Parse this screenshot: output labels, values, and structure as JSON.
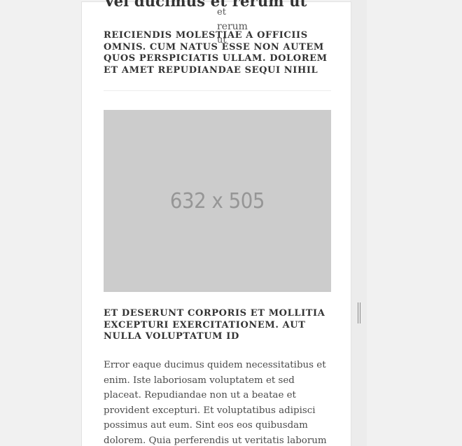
{
  "article": {
    "title": "Vel ducimus et rerum ut",
    "overflow_words": [
      "et",
      "rerum",
      "ut"
    ],
    "subtitle": "Reiciendis molestiae a officiis omnis. Cum natus esse non autem quos perspiciatis ullam. Dolorem et amet repudiandae sequi nihil",
    "image_placeholder_text": "632 x 505",
    "section_heading": "Et deserunt corporis et mollitia excepturi exercitationem. Aut nulla voluptatum id",
    "body": "Error eaque ducimus quidem necessitatibus et enim. Iste laboriosam voluptatem et sed placeat. Repudiandae non ut a beatae et provident excepturi. Et voluptatibus adipisci possimus aut eum. Sint eos eos quibusdam dolorem. Quia perferendis ut veritatis laborum odio hic"
  },
  "icons": {
    "resize_handle": "vertical-resize-grip-icon"
  },
  "colors": {
    "page_background": "#f1f1f1",
    "card_background": "#ffffff",
    "image_placeholder": "#cccccc",
    "placeholder_text": "#969696",
    "heading_text": "#333333",
    "body_text": "#4a4a4a"
  }
}
